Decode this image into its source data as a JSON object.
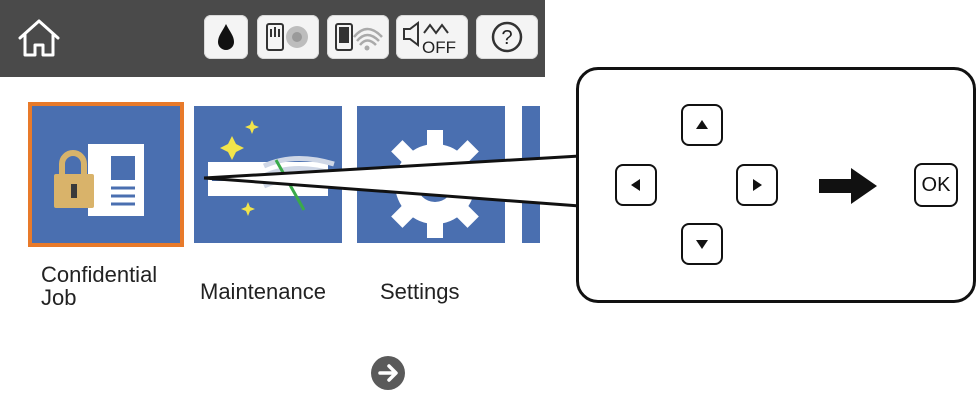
{
  "status_bar": {
    "icons": [
      "home-icon",
      "ink-drop-icon",
      "network-wired-icon",
      "wifi-direct-icon",
      "sound-off-icon",
      "help-icon"
    ],
    "sound_off_label": "OFF",
    "help_label": "?"
  },
  "tiles": [
    {
      "id": "confidential",
      "label_line1": "Confidential",
      "label_line2": "Job",
      "icon": "lock-document-icon",
      "selected": true
    },
    {
      "id": "maintenance",
      "label_line1": "Maintenance",
      "icon": "printhead-cleaning-icon",
      "selected": false
    },
    {
      "id": "settings",
      "label_line1": "Settings",
      "icon": "gear-icon",
      "selected": false
    }
  ],
  "pager": {
    "icon": "arrow-right-circle-icon"
  },
  "callout": {
    "keys": [
      "up-key",
      "left-key",
      "right-key",
      "down-key"
    ],
    "arrow_icon": "arrow-right-icon",
    "ok_label": "OK"
  },
  "colors": {
    "topbar": "#4a4a4a",
    "tile": "#4a6fb0",
    "selection": "#e87a2a"
  }
}
